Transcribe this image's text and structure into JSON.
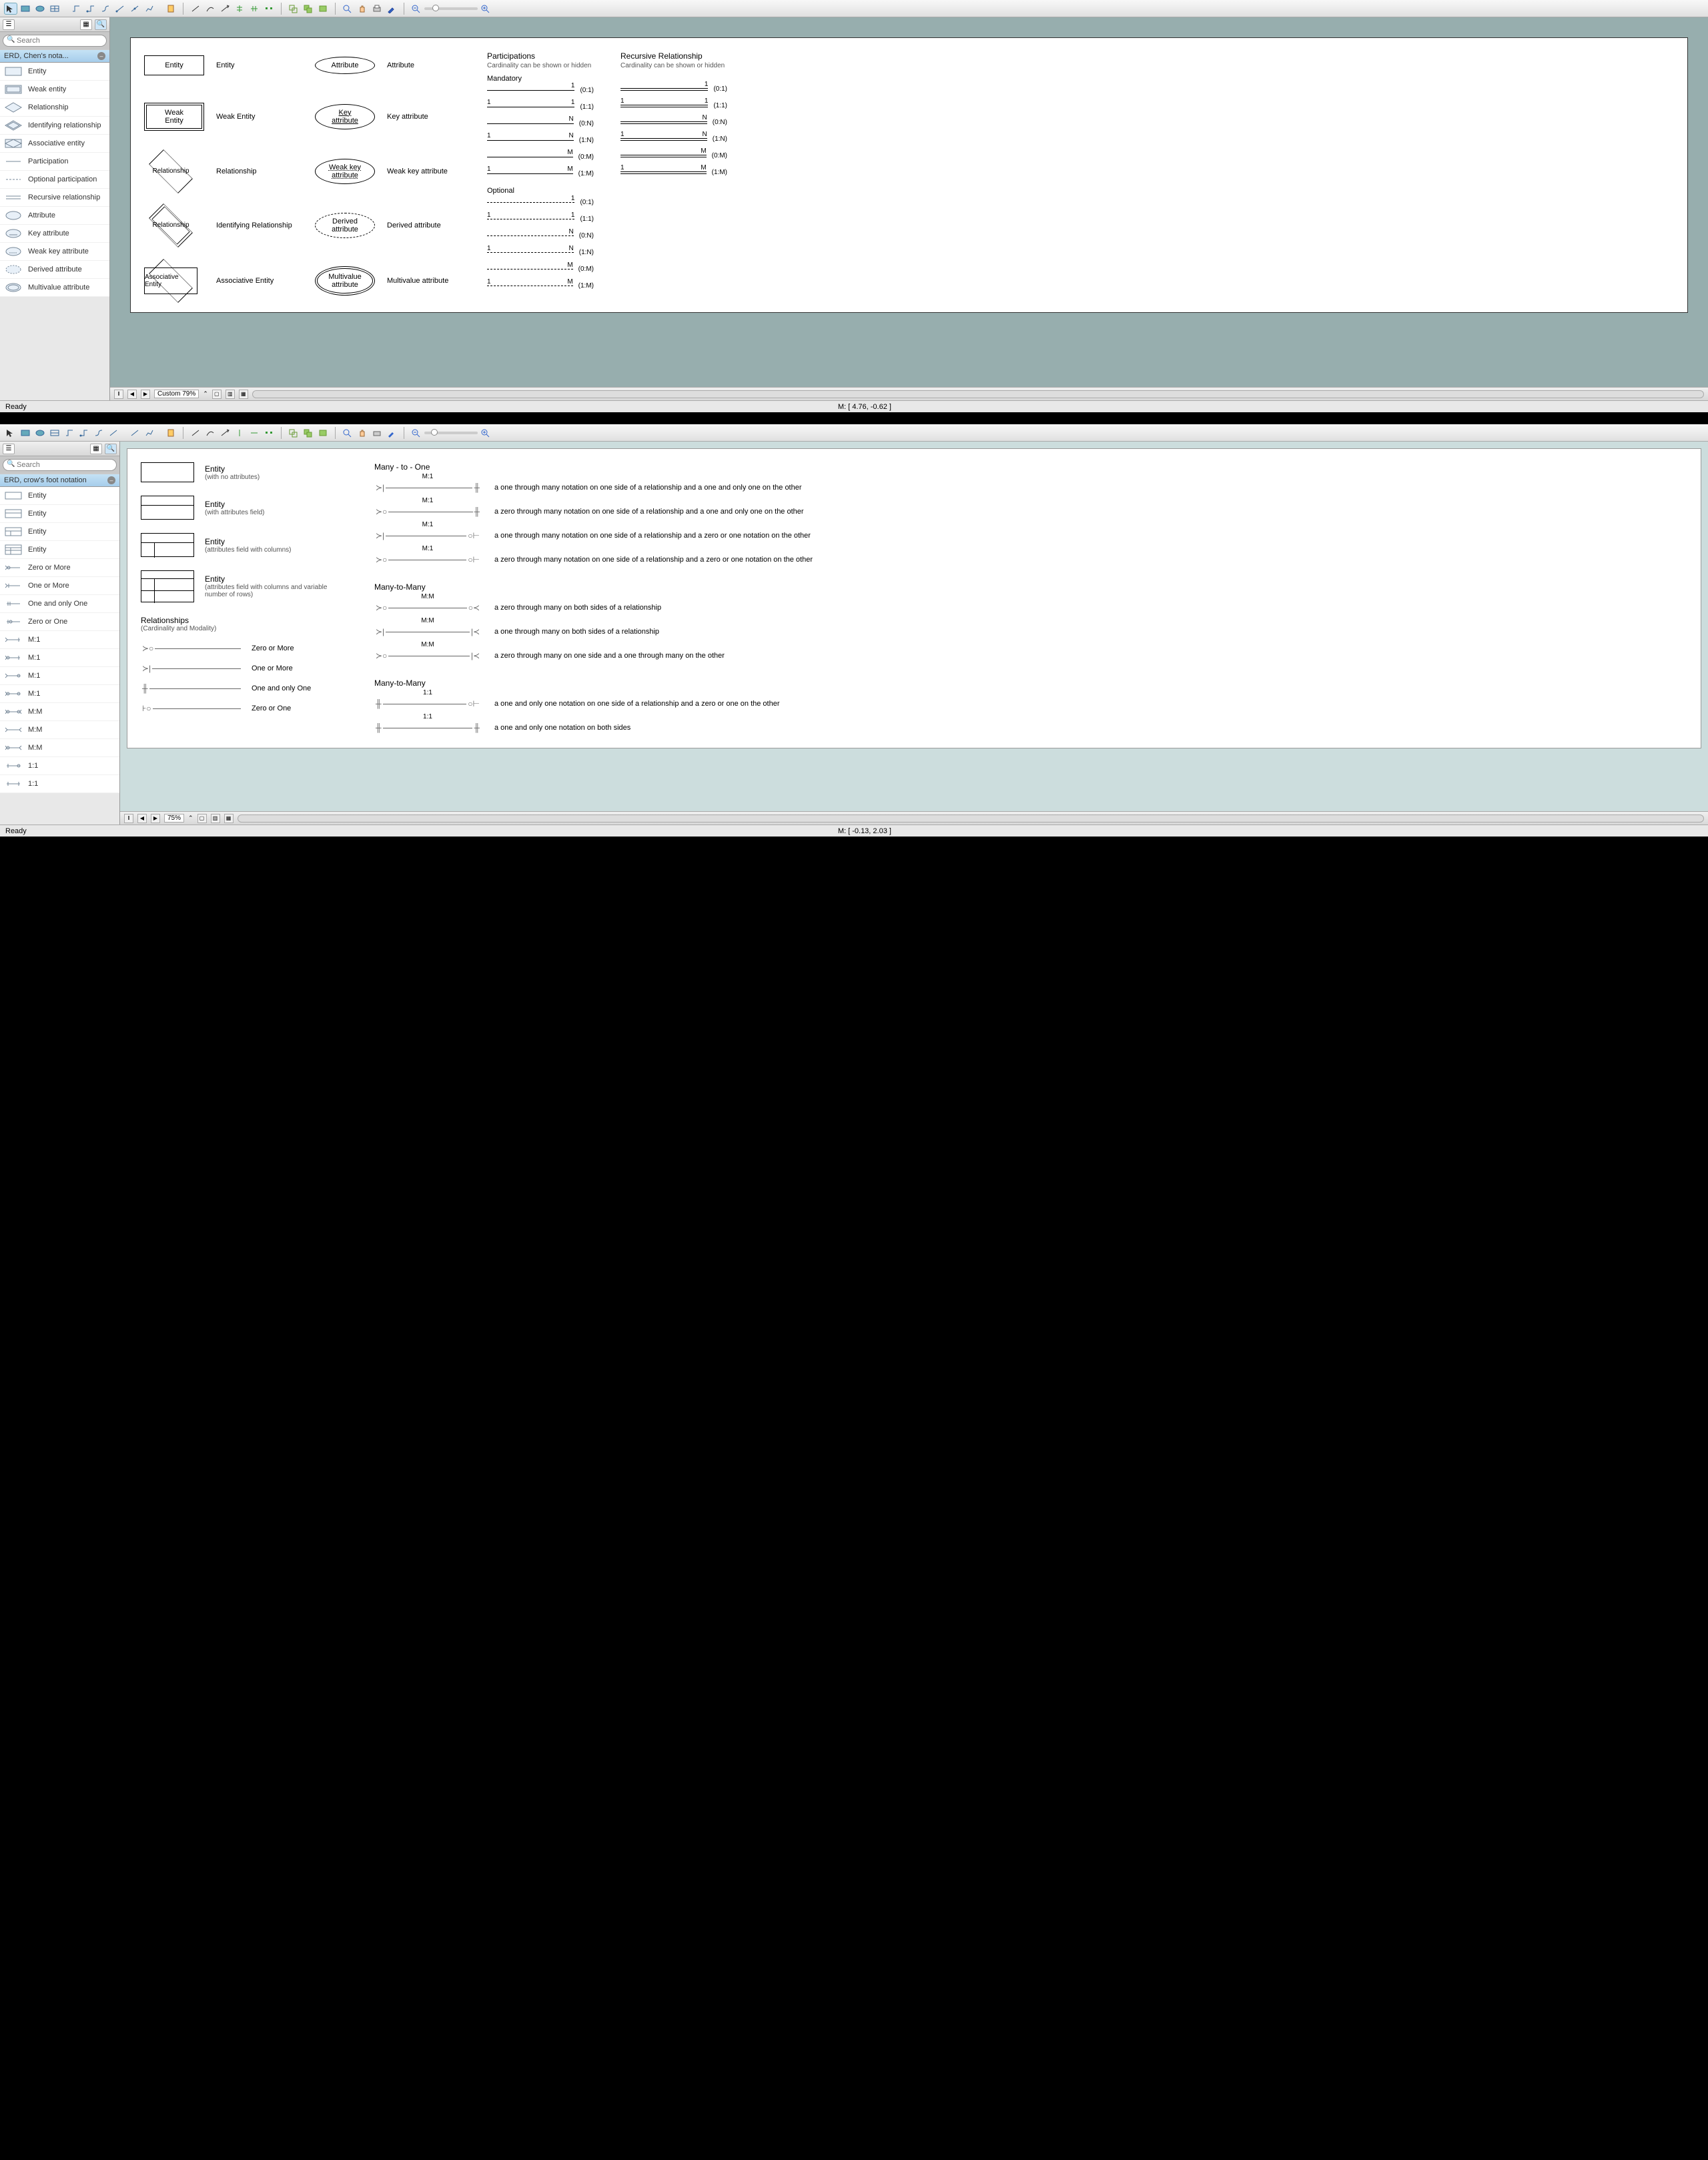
{
  "app1": {
    "search_placeholder": "Search",
    "palette_title": "ERD, Chen's nota...",
    "palette_items": [
      "Entity",
      "Weak entity",
      "Relationship",
      "Identifying relationship",
      "Associative entity",
      "Participation",
      "Optional participation",
      "Recursive relationship",
      "Attribute",
      "Key attribute",
      "Weak key attribute",
      "Derived attribute",
      "Multivalue attribute"
    ],
    "canvas": {
      "col1_shapes": [
        "Entity",
        "Weak Entity",
        "Relationship",
        "Relationship",
        "Associative Entity"
      ],
      "col1_labels": [
        "Entity",
        "Weak Entity",
        "Relationship",
        "Identifying Relationship",
        "Associative Entity"
      ],
      "col2_shapes": [
        "Attribute",
        "Key attribute",
        "Weak key attribute",
        "Derived attribute",
        "Multivalue attribute"
      ],
      "col2_labels": [
        "Attribute",
        "Key attribute",
        "Weak key attribute",
        "Derived attribute",
        "Multivalue attribute"
      ],
      "participations_title": "Participations",
      "participations_sub": "Cardinality can be shown or hidden",
      "mandatory_title": "Mandatory",
      "mandatory_rows": [
        {
          "l": "",
          "r": "1",
          "card": "(0:1)"
        },
        {
          "l": "1",
          "r": "1",
          "card": "(1:1)"
        },
        {
          "l": "",
          "r": "N",
          "card": "(0:N)"
        },
        {
          "l": "1",
          "r": "N",
          "card": "(1:N)"
        },
        {
          "l": "",
          "r": "M",
          "card": "(0:M)"
        },
        {
          "l": "1",
          "r": "M",
          "card": "(1:M)"
        }
      ],
      "optional_title": "Optional",
      "optional_rows": [
        {
          "l": "",
          "r": "1",
          "card": "(0:1)"
        },
        {
          "l": "1",
          "r": "1",
          "card": "(1:1)"
        },
        {
          "l": "",
          "r": "N",
          "card": "(0:N)"
        },
        {
          "l": "1",
          "r": "N",
          "card": "(1:N)"
        },
        {
          "l": "",
          "r": "M",
          "card": "(0:M)"
        },
        {
          "l": "1",
          "r": "M",
          "card": "(1:M)"
        }
      ],
      "recursive_title": "Recursive Relationship",
      "recursive_sub": "Cardinality can be shown or hidden",
      "recursive_rows": [
        {
          "l": "",
          "r": "1",
          "card": "(0:1)"
        },
        {
          "l": "1",
          "r": "1",
          "card": "(1:1)"
        },
        {
          "l": "",
          "r": "N",
          "card": "(0:N)"
        },
        {
          "l": "1",
          "r": "N",
          "card": "(1:N)"
        },
        {
          "l": "",
          "r": "M",
          "card": "(0:M)"
        },
        {
          "l": "1",
          "r": "M",
          "card": "(1:M)"
        }
      ]
    },
    "zoom_label": "Custom 79%",
    "status_ready": "Ready",
    "status_coords": "M: [ 4.76, -0.62 ]"
  },
  "app2": {
    "search_placeholder": "Search",
    "palette_title": "ERD, crow's foot notation",
    "palette_items": [
      "Entity",
      "Entity",
      "Entity",
      "Entity",
      "Zero or More",
      "One or More",
      "One and only One",
      "Zero or One",
      "M:1",
      "M:1",
      "M:1",
      "M:1",
      "M:M",
      "M:M",
      "M:M",
      "1:1",
      "1:1"
    ],
    "canvas": {
      "entities": [
        {
          "title": "Entity",
          "sub": "(with no attributes)"
        },
        {
          "title": "Entity",
          "sub": "(with attributes field)"
        },
        {
          "title": "Entity",
          "sub": "(attributes field with columns)"
        },
        {
          "title": "Entity",
          "sub": "(attributes field with columns and variable number of rows)"
        }
      ],
      "rel_header": "Relationships",
      "rel_sub": "(Cardinality and Modality)",
      "basic_rels": [
        "Zero or More",
        "One or More",
        "One and only One",
        "Zero or One"
      ],
      "m1_title": "Many - to - One",
      "m1_rows": [
        {
          "label": "M:1",
          "desc": "a one through many notation on one side of a relationship and a one and only one on the other"
        },
        {
          "label": "M:1",
          "desc": "a zero through many notation on one side of a relationship and a one and only one on the other"
        },
        {
          "label": "M:1",
          "desc": "a one through many notation on one side of a relationship and a zero or one notation on the other"
        },
        {
          "label": "M:1",
          "desc": "a zero through many notation on one side of a relationship and a zero or one notation on the other"
        }
      ],
      "mm_title": "Many-to-Many",
      "mm_rows": [
        {
          "label": "M:M",
          "desc": "a zero through many on both sides of a relationship"
        },
        {
          "label": "M:M",
          "desc": "a one through many on both sides of a relationship"
        },
        {
          "label": "M:M",
          "desc": "a zero through many on one side and a one through many on the other"
        }
      ],
      "oo_title": "Many-to-Many",
      "oo_rows": [
        {
          "label": "1:1",
          "desc": "a one and only one notation on one side of a relationship and a zero or one on the other"
        },
        {
          "label": "1:1",
          "desc": "a one and only one notation on both sides"
        }
      ]
    },
    "zoom_label": "75%",
    "status_ready": "Ready",
    "status_coords": "M: [ -0.13, 2.03 ]"
  }
}
